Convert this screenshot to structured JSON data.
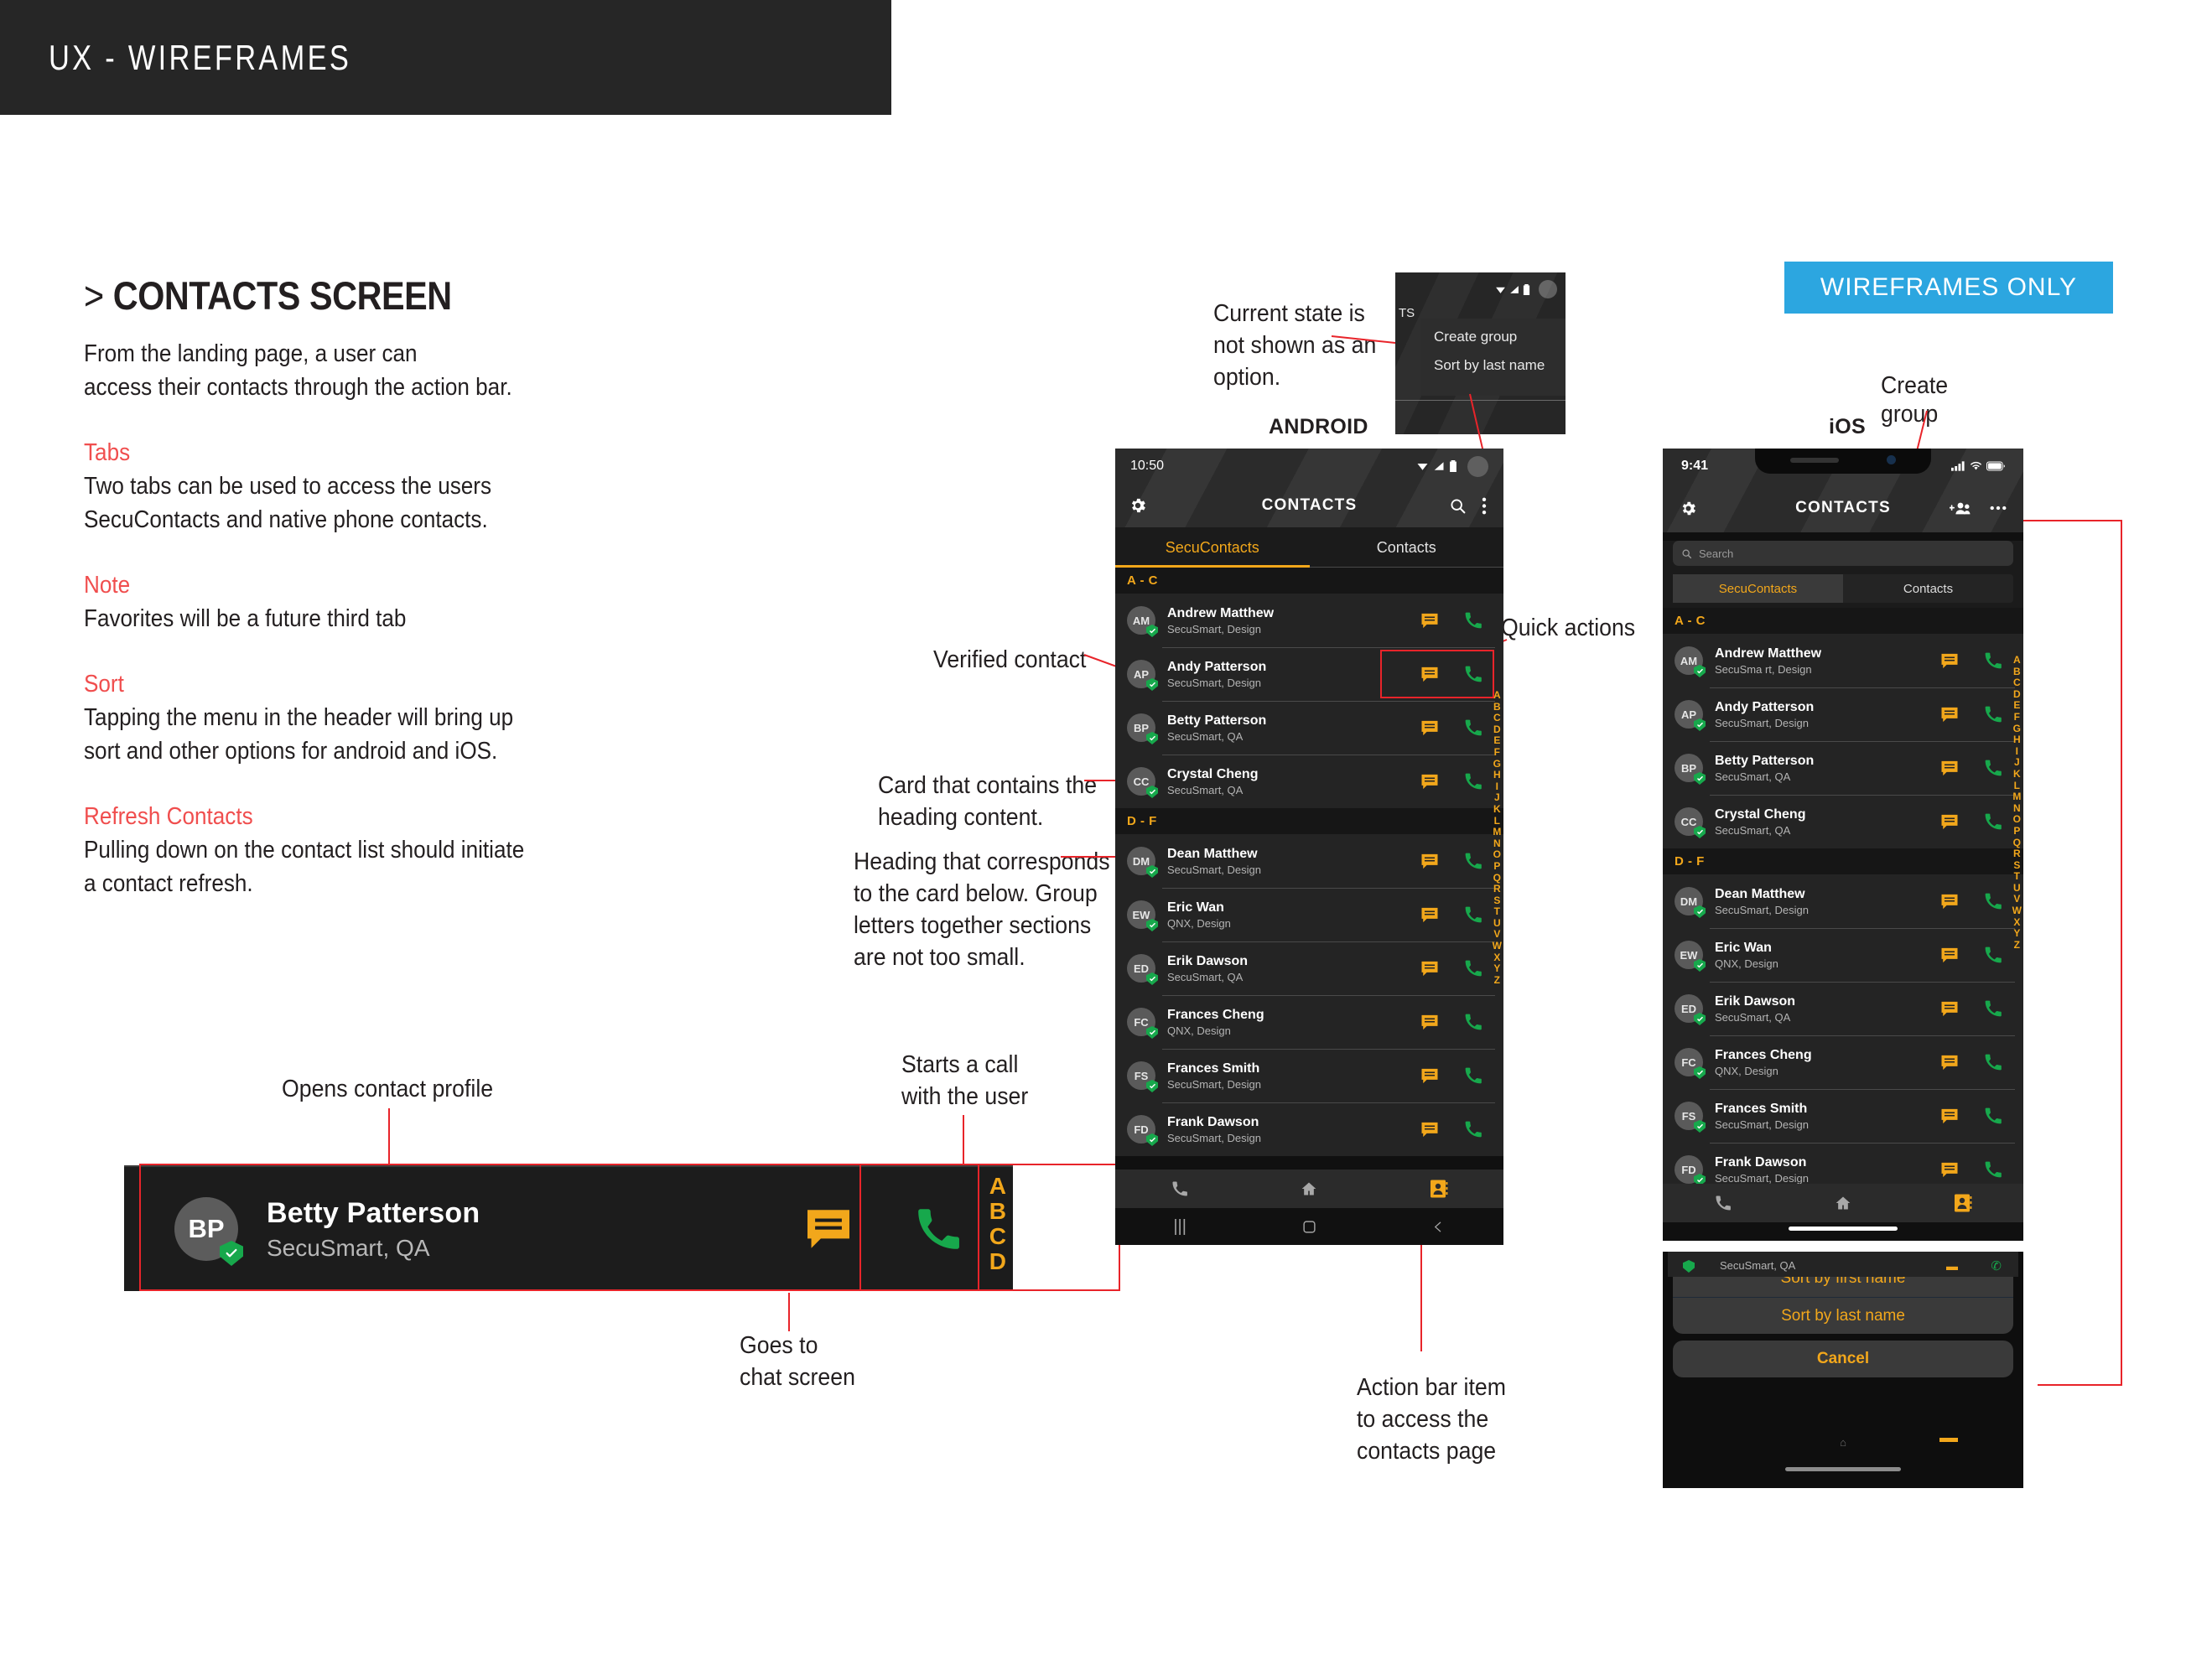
{
  "header": {
    "title": "UX - WIREFRAMES"
  },
  "badge": {
    "label": "WIREFRAMES ONLY",
    "color": "#2ca6e0"
  },
  "section": {
    "chevron": ">",
    "title": "CONTACTS SCREEN",
    "intro": "From the landing page, a user can\naccess their contacts through the action bar.",
    "blocks": [
      {
        "heading": "Tabs",
        "body": "Two tabs can be used to access the users\nSecuContacts and native phone contacts."
      },
      {
        "heading": "Note",
        "body": "Favorites will be a future third tab"
      },
      {
        "heading": "Sort",
        "body": "Tapping the menu in the header will bring up\nsort and other options for android and iOS."
      },
      {
        "heading": "Refresh Contacts",
        "body": "Pulling down on the contact list should initiate\na contact refresh."
      }
    ],
    "heading_color": "#f04e4e"
  },
  "detail_card": {
    "avatar_initials": "BP",
    "name": "Betty Patterson",
    "subtitle": "SecuSmart, QA",
    "index_letters": [
      "A",
      "B",
      "C",
      "D"
    ],
    "chat_icon": "chat-bubble-icon",
    "call_icon": "phone-handset-icon",
    "verified_icon": "verified-shield-icon",
    "annotations": {
      "profile": "Opens contact profile",
      "call": "Starts a call\nwith the user",
      "chat": "Goes to\nchat screen"
    }
  },
  "annotations": {
    "current_state": "Current state is\nnot shown as an\noption.",
    "verified_contact": "Verified contact",
    "card_heading": "Card that contains the\nheading content.",
    "heading_corresponds": "Heading that corresponds\nto the card below. Group\nletters together sections\nare not too small.",
    "quick_actions": "Quick actions",
    "action_bar_item": "Action bar item\nto access the\ncontacts page",
    "create_group": "Create\ngroup"
  },
  "platform_labels": {
    "android": "ANDROID",
    "ios": "iOS"
  },
  "android_popup": {
    "items": [
      "Create group",
      "Sort by last name"
    ]
  },
  "android": {
    "status": {
      "time": "10:50",
      "icons": [
        "wifi-icon",
        "signal-icon",
        "battery-icon",
        "avatar-circle"
      ]
    },
    "actionbar": {
      "title": "CONTACTS",
      "settings_icon": "gear-icon",
      "search_icon": "search-icon",
      "overflow_icon": "kebab-menu-icon"
    },
    "tabs": [
      {
        "label": "SecuContacts",
        "active": true
      },
      {
        "label": "Contacts",
        "active": false
      }
    ],
    "sections": [
      {
        "heading": "A - C",
        "contacts": [
          {
            "initials": "AM",
            "name": "Andrew Matthew",
            "sub": "SecuSmart, Design"
          },
          {
            "initials": "AP",
            "name": "Andy Patterson",
            "sub": "SecuSmart, Design"
          },
          {
            "initials": "BP",
            "name": "Betty Patterson",
            "sub": "SecuSmart, QA"
          },
          {
            "initials": "CC",
            "name": "Crystal Cheng",
            "sub": "SecuSmart, QA"
          }
        ]
      },
      {
        "heading": "D - F",
        "contacts": [
          {
            "initials": "DM",
            "name": "Dean Matthew",
            "sub": "SecuSmart, Design"
          },
          {
            "initials": "EW",
            "name": "Eric Wan",
            "sub": "QNX, Design"
          },
          {
            "initials": "ED",
            "name": "Erik Dawson",
            "sub": "SecuSmart, QA"
          },
          {
            "initials": "FC",
            "name": "Frances Cheng",
            "sub": "QNX, Design"
          },
          {
            "initials": "FS",
            "name": "Frances Smith",
            "sub": "SecuSmart, Design"
          },
          {
            "initials": "FD",
            "name": "Frank Dawson",
            "sub": "SecuSmart, Design"
          }
        ]
      }
    ],
    "index": [
      "A",
      "B",
      "C",
      "D",
      "E",
      "F",
      "G",
      "H",
      "I",
      "J",
      "K",
      "L",
      "M",
      "N",
      "O",
      "P",
      "Q",
      "R",
      "S",
      "T",
      "U",
      "V",
      "W",
      "X",
      "Y",
      "Z"
    ],
    "navbar": [
      "phone-icon",
      "home-icon",
      "contacts-book-icon"
    ],
    "sysnav": [
      "recents-icon",
      "home-square-icon",
      "back-icon"
    ]
  },
  "ios": {
    "status": {
      "time": "9:41",
      "icons": [
        "signal-bars-icon",
        "wifi-icon",
        "battery-icon"
      ]
    },
    "actionbar": {
      "title": "CONTACTS",
      "settings_icon": "gear-icon",
      "add_group_icon": "add-people-icon",
      "more_icon": "ellipsis-icon"
    },
    "search": {
      "placeholder": "Search",
      "icon": "search-icon"
    },
    "tabs": [
      {
        "label": "SecuContacts",
        "active": true
      },
      {
        "label": "Contacts",
        "active": false
      }
    ],
    "sections": [
      {
        "heading": "A - C",
        "contacts": [
          {
            "initials": "AM",
            "name": "Andrew Matthew",
            "sub": "SecuSma rt, Design"
          },
          {
            "initials": "AP",
            "name": "Andy Patterson",
            "sub": "SecuSmart, Design"
          },
          {
            "initials": "BP",
            "name": "Betty Patterson",
            "sub": "SecuSmart, QA"
          },
          {
            "initials": "CC",
            "name": "Crystal Cheng",
            "sub": "SecuSmart, QA"
          }
        ]
      },
      {
        "heading": "D - F",
        "contacts": [
          {
            "initials": "DM",
            "name": "Dean Matthew",
            "sub": "SecuSmart, Design"
          },
          {
            "initials": "EW",
            "name": "Eric Wan",
            "sub": "QNX, Design"
          },
          {
            "initials": "ED",
            "name": "Erik Dawson",
            "sub": "SecuSmart, QA"
          },
          {
            "initials": "FC",
            "name": "Frances Cheng",
            "sub": "QNX, Design"
          },
          {
            "initials": "FS",
            "name": "Frances Smith",
            "sub": "SecuSmart, Design"
          },
          {
            "initials": "FD",
            "name": "Frank Dawson",
            "sub": "SecuSmart, Design"
          }
        ]
      }
    ],
    "index": [
      "A",
      "B",
      "C",
      "D",
      "E",
      "F",
      "G",
      "H",
      "I",
      "J",
      "K",
      "L",
      "M",
      "N",
      "O",
      "P",
      "Q",
      "R",
      "S",
      "T",
      "U",
      "V",
      "W",
      "X",
      "Y",
      "Z"
    ],
    "navbar": [
      "phone-icon",
      "home-icon",
      "contacts-book-icon"
    ],
    "action_sheet": {
      "options": [
        "Sort by first name",
        "Sort by last name"
      ],
      "cancel": "Cancel"
    }
  },
  "colors": {
    "accent_amber": "#f2a71b",
    "verified_green": "#17a84c",
    "annotation_red": "#e8242a",
    "heading_red": "#f04e4e",
    "badge_blue": "#2ca6e0",
    "dark_bg": "#1c1c1c"
  }
}
